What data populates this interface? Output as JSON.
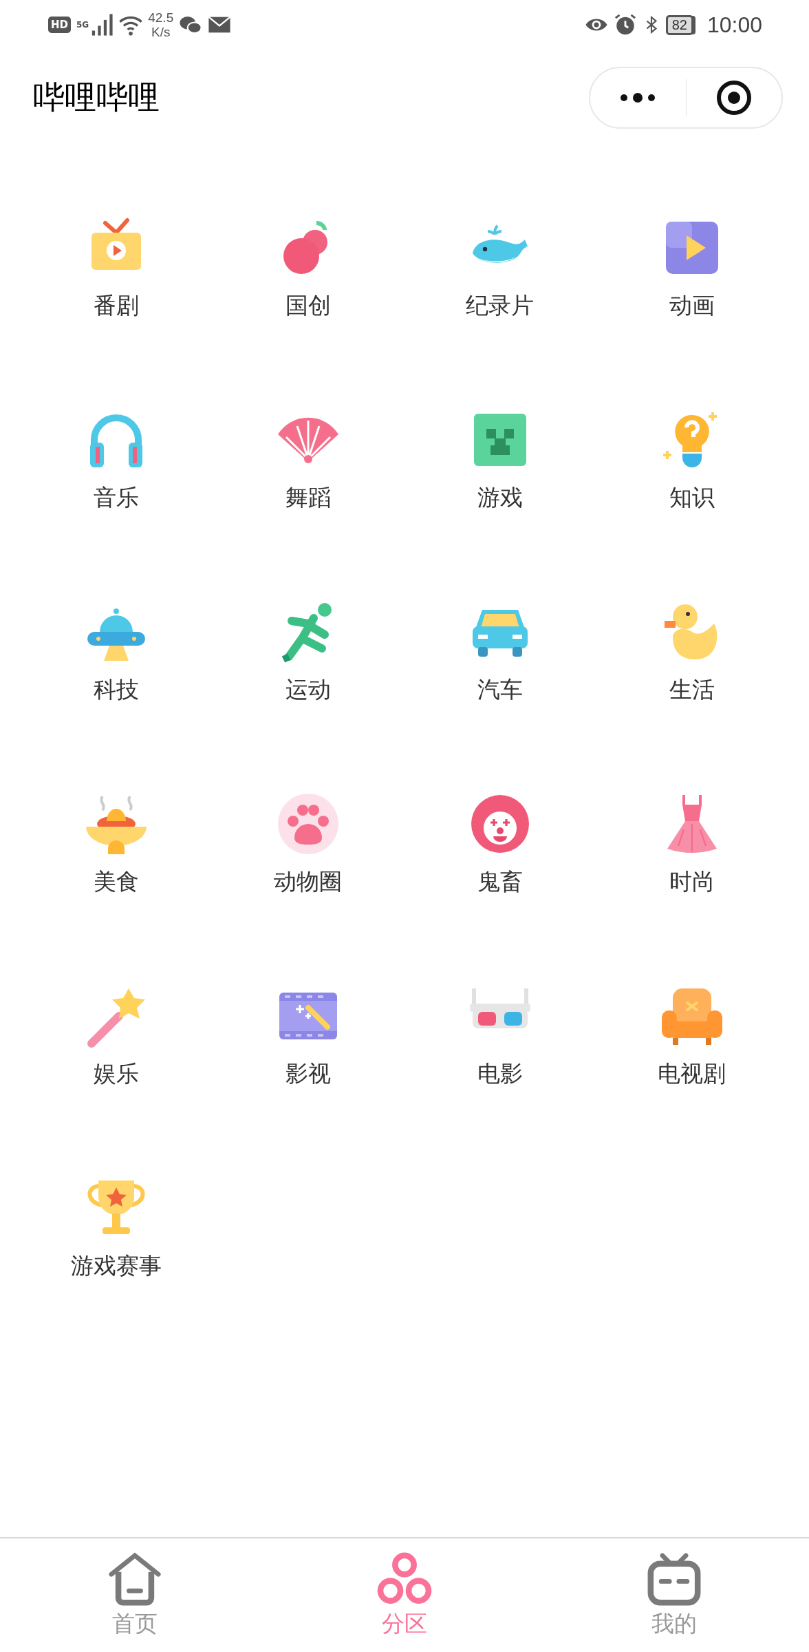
{
  "status_bar": {
    "hd": "HD",
    "network": "5G",
    "speed_value": "42.5",
    "speed_unit": "K/s",
    "battery": "82",
    "time": "10:00"
  },
  "header": {
    "title": "哔哩哔哩"
  },
  "categories": [
    {
      "label": "番剧"
    },
    {
      "label": "国创"
    },
    {
      "label": "纪录片"
    },
    {
      "label": "动画"
    },
    {
      "label": "音乐"
    },
    {
      "label": "舞蹈"
    },
    {
      "label": "游戏"
    },
    {
      "label": "知识"
    },
    {
      "label": "科技"
    },
    {
      "label": "运动"
    },
    {
      "label": "汽车"
    },
    {
      "label": "生活"
    },
    {
      "label": "美食"
    },
    {
      "label": "动物圈"
    },
    {
      "label": "鬼畜"
    },
    {
      "label": "时尚"
    },
    {
      "label": "娱乐"
    },
    {
      "label": "影视"
    },
    {
      "label": "电影"
    },
    {
      "label": "电视剧"
    },
    {
      "label": "游戏赛事"
    }
  ],
  "tab_bar": [
    {
      "label": "首页",
      "selected": false
    },
    {
      "label": "分区",
      "selected": true
    },
    {
      "label": "我的",
      "selected": false
    }
  ]
}
